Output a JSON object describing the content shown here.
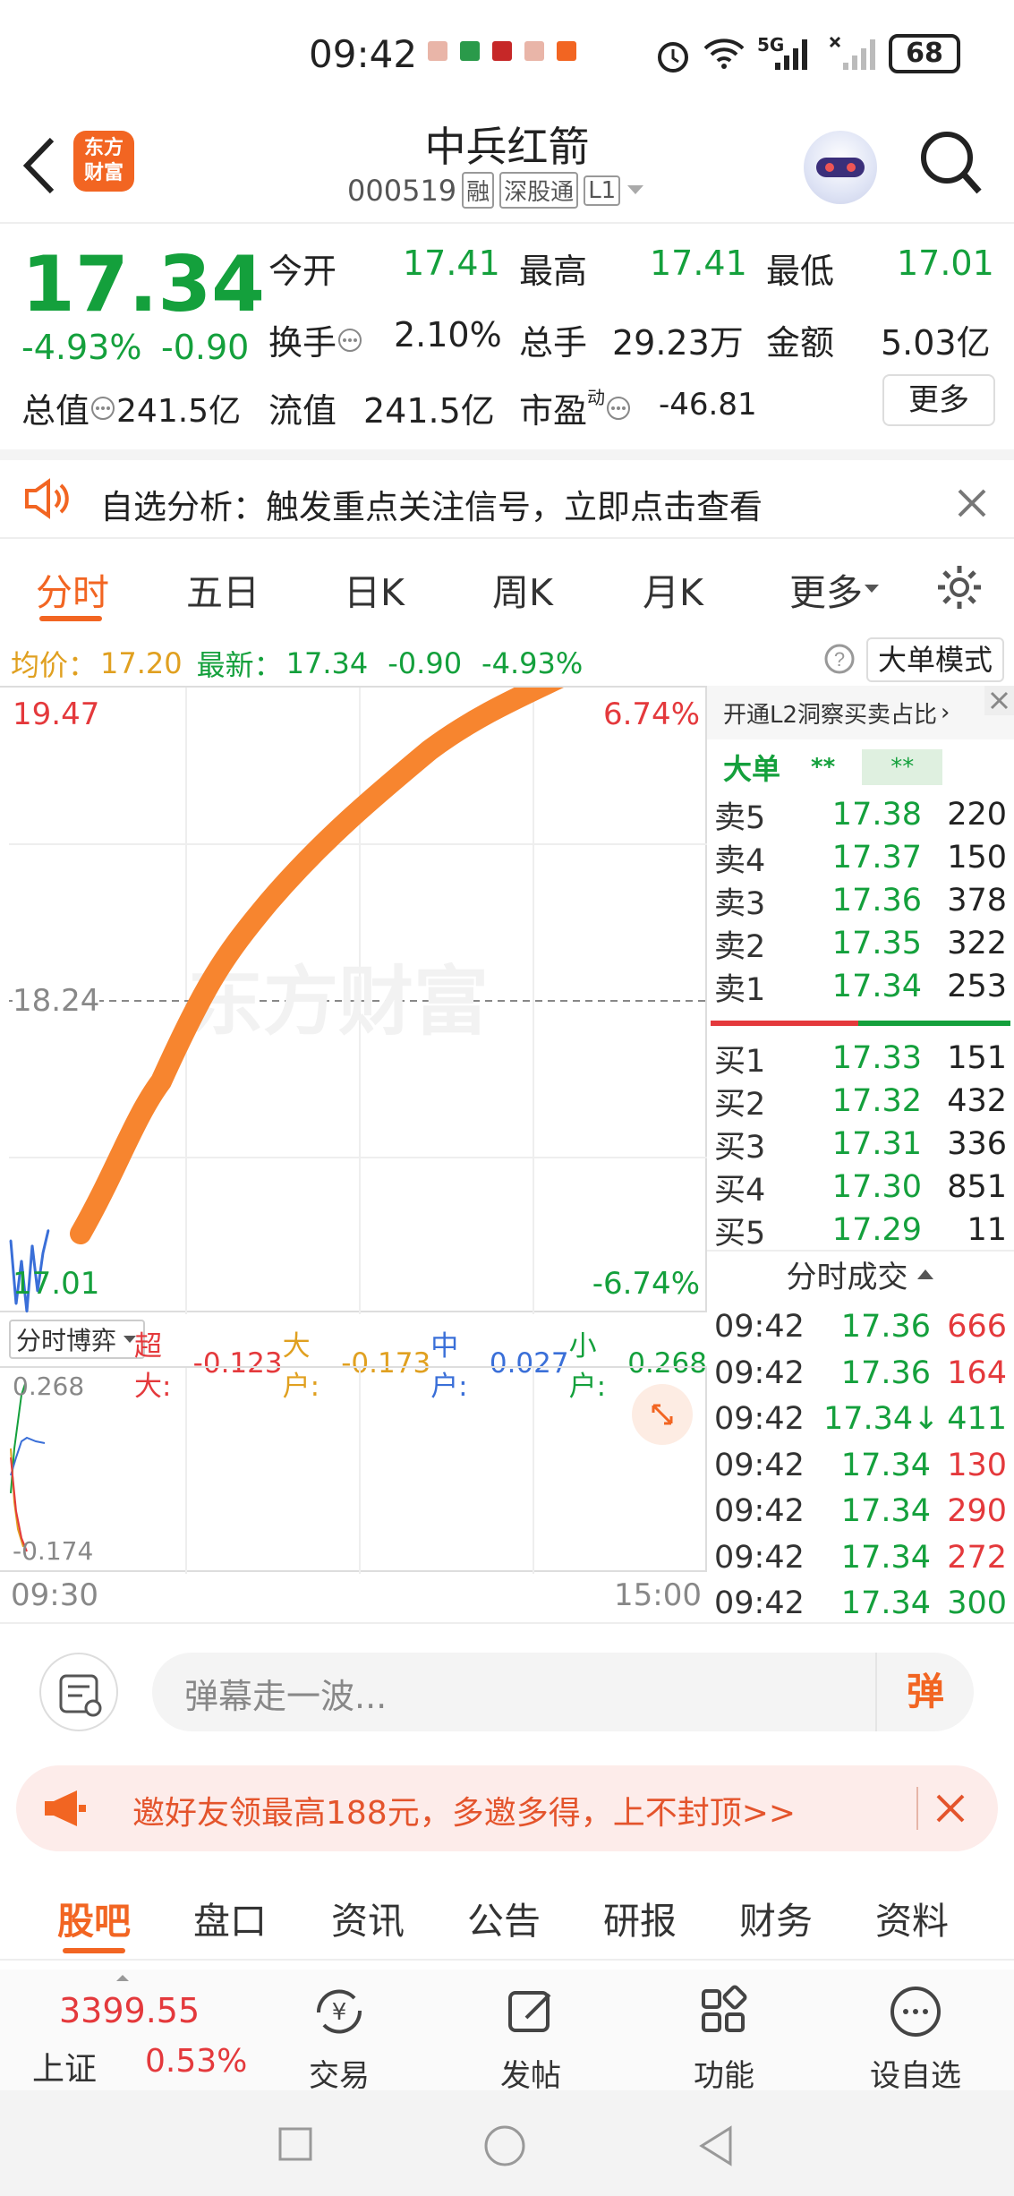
{
  "status_bar": {
    "time": "09:42",
    "signal_label": "5G",
    "battery": "68"
  },
  "header": {
    "title": "中兵红箭",
    "code": "000519",
    "badges": [
      "融",
      "深股通",
      "L1"
    ]
  },
  "quote": {
    "price": "17.34",
    "change_pct": "-4.93%",
    "change_abs": "-0.90",
    "open_label": "今开",
    "open": "17.41",
    "high_label": "最高",
    "high": "17.41",
    "low_label": "最低",
    "low": "17.01",
    "turnover_label": "换手",
    "turnover": "2.10%",
    "volume_label": "总手",
    "volume": "29.23万",
    "amount_label": "金额",
    "amount": "5.03亿",
    "total_cap_label": "总值",
    "total_cap": "241.5亿",
    "float_cap_label": "流值",
    "float_cap": "241.5亿",
    "pe_label": "市盈",
    "pe_sup": "动",
    "pe": "-46.81",
    "more_button": "更多"
  },
  "notice": {
    "text": "自选分析：触发重点关注信号，立即点击查看"
  },
  "tabs": [
    "分时",
    "五日",
    "日K",
    "周K",
    "月K",
    "更多"
  ],
  "chart_bar": {
    "avg_label": "均价：",
    "avg": "17.20",
    "latest_label": "最新：",
    "latest": "17.34",
    "change": "-0.90",
    "change_pct": "-4.93%",
    "mode_button": "大单模式"
  },
  "chart_data": {
    "type": "line",
    "y_labels": {
      "top": "19.47",
      "mid": "18.24",
      "bottom": "17.01"
    },
    "pct_labels": {
      "top": "6.74%",
      "bottom": "-6.74%"
    },
    "ylim": [
      17.01,
      19.47
    ],
    "x_labels": [
      "09:30",
      "15:00"
    ],
    "series": [
      {
        "values": [
          17.3,
          17.05,
          17.22,
          17.02,
          17.28,
          17.1,
          17.25,
          17.34
        ]
      }
    ],
    "annotation_stroke_color": "#f7852f"
  },
  "watermark": "东方财富",
  "sub_chart": {
    "selector": "分时博弈",
    "items": [
      {
        "label": "超大:",
        "value": "-0.123",
        "color": "#e4393c"
      },
      {
        "label": "大户:",
        "value": "-0.173",
        "color": "#e0a020"
      },
      {
        "label": "中户:",
        "value": "0.027",
        "color": "#3a6fd8"
      },
      {
        "label": "小户:",
        "value": "0.268",
        "color": "#14a03c"
      }
    ],
    "top": "0.268",
    "bottom": "-0.174"
  },
  "order_book": {
    "banner": "开通L2洞察买卖占比",
    "big_order_label": "大单",
    "big_buy": "**",
    "big_sell": "**",
    "asks": [
      {
        "label": "卖5",
        "price": "17.38",
        "vol": "220"
      },
      {
        "label": "卖4",
        "price": "17.37",
        "vol": "150"
      },
      {
        "label": "卖3",
        "price": "17.36",
        "vol": "378"
      },
      {
        "label": "卖2",
        "price": "17.35",
        "vol": "322"
      },
      {
        "label": "卖1",
        "price": "17.34",
        "vol": "253"
      }
    ],
    "bids": [
      {
        "label": "买1",
        "price": "17.33",
        "vol": "151"
      },
      {
        "label": "买2",
        "price": "17.32",
        "vol": "432"
      },
      {
        "label": "买3",
        "price": "17.31",
        "vol": "336"
      },
      {
        "label": "买4",
        "price": "17.30",
        "vol": "851"
      },
      {
        "label": "买5",
        "price": "17.29",
        "vol": "11"
      }
    ],
    "trades_title": "分时成交",
    "trades": [
      {
        "time": "09:42",
        "price": "17.36",
        "vol": "666",
        "pc": "green",
        "vc": "red"
      },
      {
        "time": "09:42",
        "price": "17.36",
        "vol": "164",
        "pc": "green",
        "vc": "red"
      },
      {
        "time": "09:42",
        "price": "17.34↓",
        "vol": "411",
        "pc": "green",
        "vc": "green"
      },
      {
        "time": "09:42",
        "price": "17.34",
        "vol": "130",
        "pc": "green",
        "vc": "red"
      },
      {
        "time": "09:42",
        "price": "17.34",
        "vol": "290",
        "pc": "green",
        "vc": "red"
      },
      {
        "time": "09:42",
        "price": "17.34",
        "vol": "272",
        "pc": "green",
        "vc": "red"
      },
      {
        "time": "09:42",
        "price": "17.34",
        "vol": "300",
        "pc": "green",
        "vc": "green"
      }
    ]
  },
  "danmu": {
    "placeholder": "弹幕走一波...",
    "send_label": "弹"
  },
  "invite": {
    "text": "邀好友领最高188元，多邀多得，上不封顶>>"
  },
  "sub_tabs": [
    "股吧",
    "盘口",
    "资讯",
    "公告",
    "研报",
    "财务",
    "资料"
  ],
  "bottom_nav": {
    "index_value": "3399.55",
    "index_name": "上证",
    "index_pct": "0.53%",
    "items": [
      "交易",
      "发帖",
      "功能",
      "设自选"
    ]
  }
}
